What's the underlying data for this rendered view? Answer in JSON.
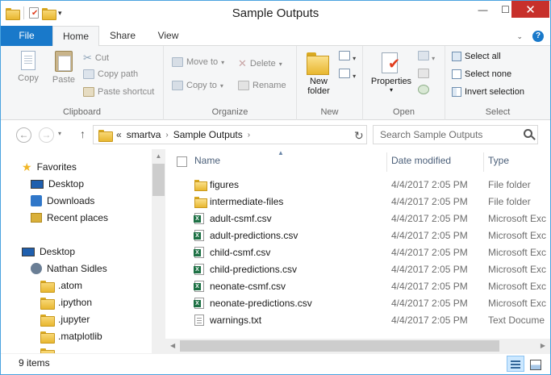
{
  "window": {
    "title": "Sample Outputs",
    "minimize_glyph": "—",
    "maximize_glyph": "☐",
    "close_glyph": "✕"
  },
  "ribbon_tabs": [
    "File",
    "Home",
    "Share",
    "View"
  ],
  "ribbon": {
    "clipboard": {
      "label": "Clipboard",
      "copy": "Copy",
      "paste": "Paste",
      "cut": "Cut",
      "copy_path": "Copy path",
      "paste_shortcut": "Paste shortcut"
    },
    "organize": {
      "label": "Organize",
      "move_to": "Move to",
      "copy_to": "Copy to",
      "delete": "Delete",
      "rename": "Rename"
    },
    "new": {
      "label": "New",
      "new_folder_line1": "New",
      "new_folder_line2": "folder"
    },
    "open": {
      "label": "Open",
      "properties": "Properties"
    },
    "select": {
      "label": "Select",
      "select_all": "Select all",
      "select_none": "Select none",
      "invert_selection": "Invert selection"
    }
  },
  "address": {
    "overflow": "«",
    "crumbs": [
      "smartva",
      "Sample Outputs"
    ],
    "search_placeholder": "Search Sample Outputs"
  },
  "nav_pane": {
    "items": [
      {
        "label": "Favorites",
        "icon": "star-icon"
      },
      {
        "label": "Desktop",
        "icon": "desktop-icon"
      },
      {
        "label": "Downloads",
        "icon": "downloads-icon"
      },
      {
        "label": "Recent places",
        "icon": "recent-places-icon"
      },
      {
        "label": "Desktop",
        "icon": "desktop-icon"
      },
      {
        "label": "Nathan Sidles",
        "icon": "user-folder-icon"
      },
      {
        "label": ".atom",
        "icon": "folder-icon"
      },
      {
        "label": ".ipython",
        "icon": "folder-icon"
      },
      {
        "label": ".jupyter",
        "icon": "folder-icon"
      },
      {
        "label": ".matplotlib",
        "icon": "folder-icon"
      }
    ]
  },
  "file_list": {
    "columns": [
      "Name",
      "Date modified",
      "Type"
    ],
    "rows": [
      {
        "name": "figures",
        "date": "4/4/2017 2:05 PM",
        "type": "File folder",
        "icon": "folder"
      },
      {
        "name": "intermediate-files",
        "date": "4/4/2017 2:05 PM",
        "type": "File folder",
        "icon": "folder"
      },
      {
        "name": "adult-csmf.csv",
        "date": "4/4/2017 2:05 PM",
        "type": "Microsoft Exc",
        "icon": "excel"
      },
      {
        "name": "adult-predictions.csv",
        "date": "4/4/2017 2:05 PM",
        "type": "Microsoft Exc",
        "icon": "excel"
      },
      {
        "name": "child-csmf.csv",
        "date": "4/4/2017 2:05 PM",
        "type": "Microsoft Exc",
        "icon": "excel"
      },
      {
        "name": "child-predictions.csv",
        "date": "4/4/2017 2:05 PM",
        "type": "Microsoft Exc",
        "icon": "excel"
      },
      {
        "name": "neonate-csmf.csv",
        "date": "4/4/2017 2:05 PM",
        "type": "Microsoft Exc",
        "icon": "excel"
      },
      {
        "name": "neonate-predictions.csv",
        "date": "4/4/2017 2:05 PM",
        "type": "Microsoft Exc",
        "icon": "excel"
      },
      {
        "name": "warnings.txt",
        "date": "4/4/2017 2:05 PM",
        "type": "Text Docume",
        "icon": "text"
      }
    ]
  },
  "status": {
    "item_count": "9 items"
  },
  "colors": {
    "accent": "#1979ca",
    "close": "#c7302b",
    "folder": "#e8b730"
  }
}
